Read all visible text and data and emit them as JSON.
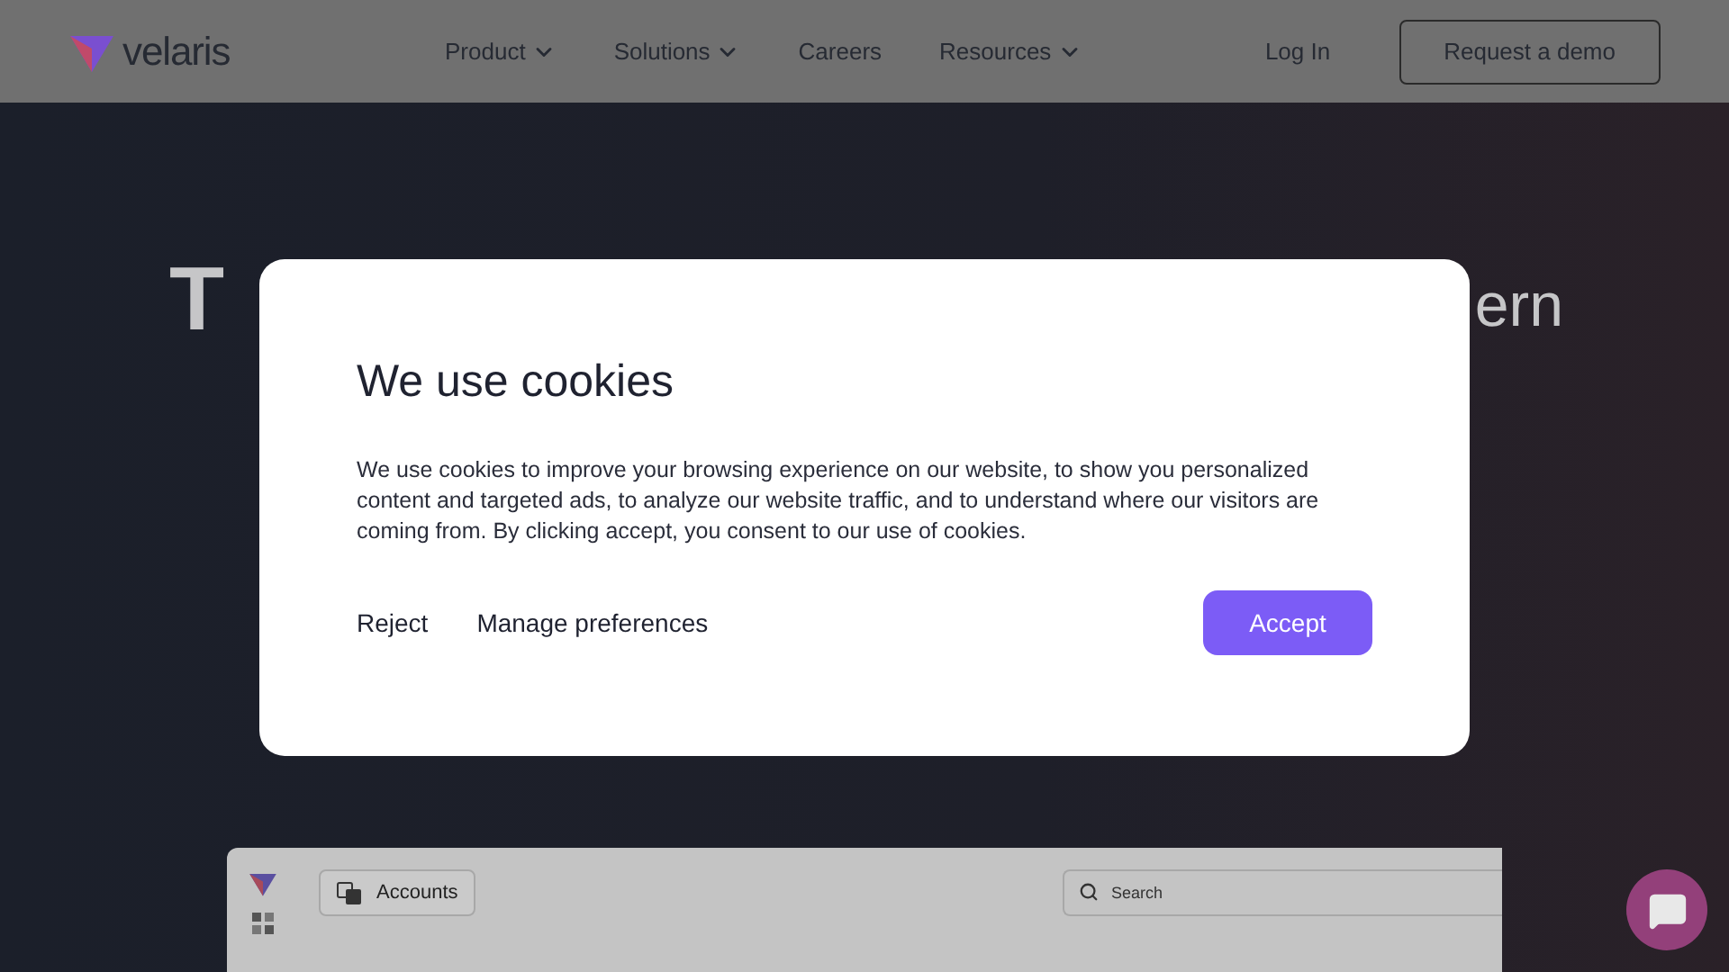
{
  "nav": {
    "brand": "velaris",
    "links": [
      {
        "label": "Product",
        "dropdown": true
      },
      {
        "label": "Solutions",
        "dropdown": true
      },
      {
        "label": "Careers",
        "dropdown": false
      },
      {
        "label": "Resources",
        "dropdown": true
      }
    ],
    "login": "Log In",
    "cta": "Request a demo"
  },
  "hero": {
    "heading_left": "T",
    "heading_right": "ern"
  },
  "cookie_dialog": {
    "title": "We use cookies",
    "body": "We use cookies to improve your browsing experience on our website, to show you personalized content and targeted ads, to analyze our website traffic, and to understand where our visitors are coming from. By clicking accept, you consent to our use of cookies.",
    "reject": "Reject",
    "manage": "Manage preferences",
    "accept": "Accept"
  },
  "preview": {
    "tab": "Accounts",
    "search": {
      "placeholder": "Search"
    }
  }
}
